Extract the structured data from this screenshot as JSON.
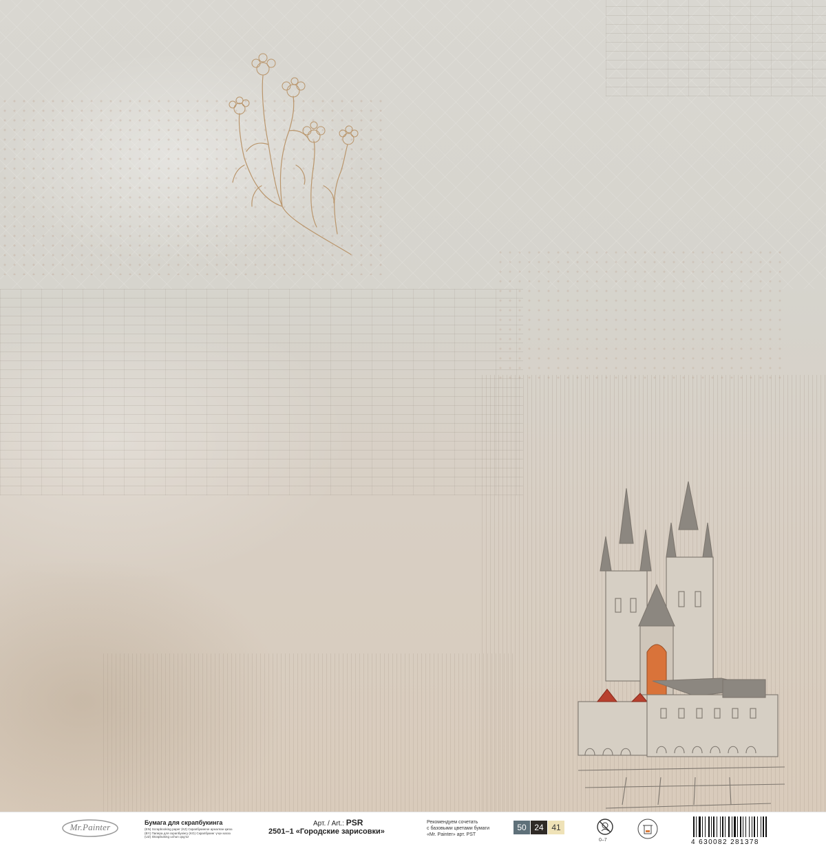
{
  "paper": {
    "colors": {
      "base": "#d8d3cb",
      "flower_line": "#b9956b",
      "roof": "#8c8780",
      "door": "#d9733a",
      "red_roof": "#b8402e"
    },
    "icons": [
      "flower-sketch",
      "church-sketch"
    ]
  },
  "footer": {
    "brand": "Mr.Painter",
    "product_type": "Бумага для скрапбукинга",
    "translations": [
      "(EN) Scrapbooking paper (KZ) Скрапбукингке арналған қағаз",
      "(BY) Папера для скрапбукінгу (KG) Скрапбукинг үчүн кагаз",
      "(UZ) Skrapbuking uchun qog'oz"
    ],
    "art_label": "Арт. / Art.:",
    "art_code": "PSR",
    "product_name": "2501–1 «Городские зарисовки»",
    "recommend_lines": [
      "Рекомендуем сочетать",
      "с базовыми цветами бумаги",
      "«Mr. Painter» арт. PST"
    ],
    "swatches": [
      {
        "label": "50",
        "bg": "#5e7079",
        "fg": "#ffffff"
      },
      {
        "label": "24",
        "bg": "#2f2a26",
        "fg": "#ffffff"
      },
      {
        "label": "41",
        "bg": "#efe2b7",
        "fg": "#333333"
      }
    ],
    "age_label": "0–7",
    "barcode_digits": "4 630082 281378"
  }
}
